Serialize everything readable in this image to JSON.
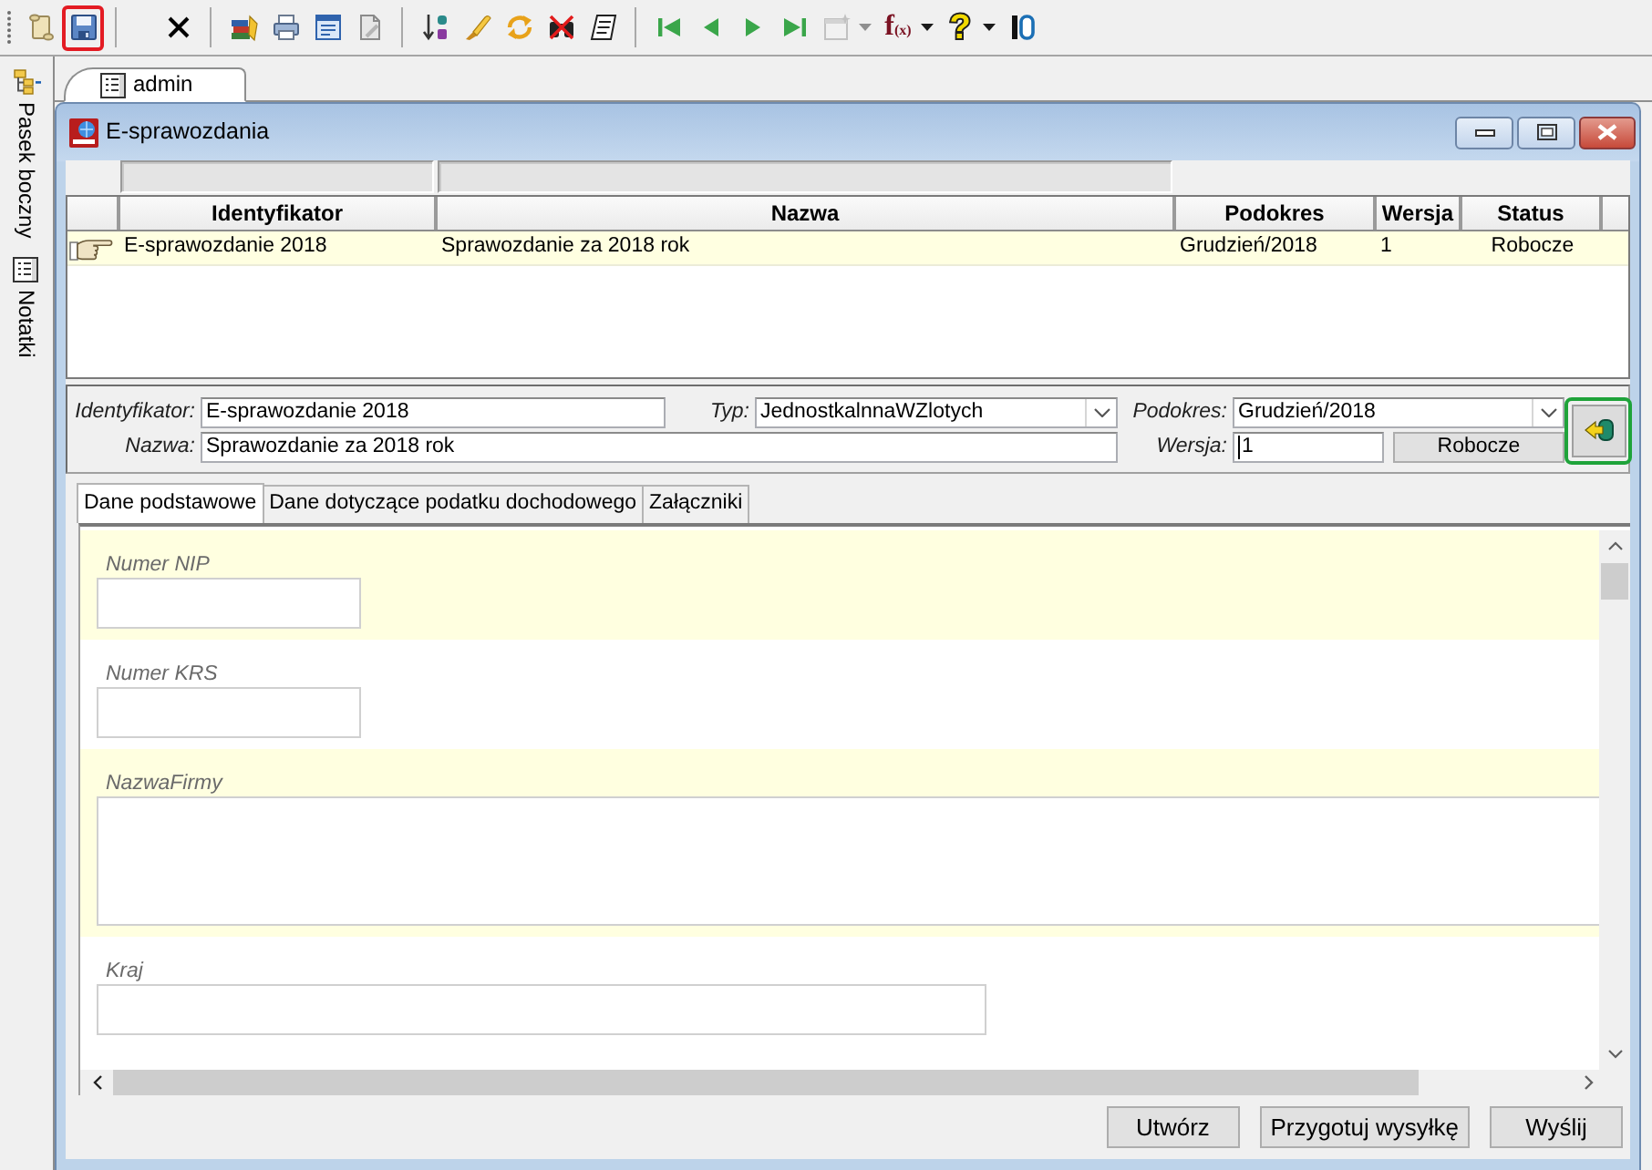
{
  "toolbar": [
    [
      {
        "kind": "button",
        "disabled": false,
        "highlighted": false
      },
      {
        "kind": "button",
        "disabled": false,
        "highlighted": true
      }
    ],
    [
      {
        "kind": "button",
        "disabled": false,
        "highlighted": false
      }
    ],
    [
      {
        "kind": "button",
        "disabled": false,
        "highlighted": false
      },
      {
        "kind": "button",
        "disabled": false,
        "highlighted": false
      },
      {
        "kind": "button",
        "disabled": false,
        "highlighted": false
      },
      {
        "kind": "button",
        "disabled": false,
        "highlighted": false
      }
    ],
    [
      {
        "kind": "button",
        "disabled": false,
        "highlighted": false
      },
      {
        "kind": "button",
        "disabled": false,
        "highlighted": false
      },
      {
        "kind": "button",
        "disabled": false,
        "highlighted": false
      },
      {
        "kind": "button",
        "disabled": false,
        "highlighted": false
      },
      {
        "kind": "button",
        "disabled": false,
        "highlighted": false
      }
    ],
    [
      {
        "kind": "button",
        "disabled": false,
        "highlighted": false
      },
      {
        "kind": "button",
        "disabled": false,
        "highlighted": false
      },
      {
        "kind": "button",
        "disabled": false,
        "highlighted": false
      },
      {
        "kind": "button",
        "disabled": false,
        "highlighted": false
      },
      {
        "kind": "dropdown",
        "disabled": true,
        "highlighted": false
      },
      {
        "kind": "dropdown",
        "disabled": false,
        "highlighted": false,
        "label": "f$_{(x)}$"
      },
      {
        "kind": "dropdown",
        "disabled": false,
        "highlighted": false,
        "label": "?"
      },
      {
        "kind": "button",
        "disabled": false,
        "highlighted": false
      }
    ]
  ],
  "sidebar": {
    "items": [
      {
        "label": "Pasek boczny"
      },
      {
        "label": "Notatki"
      }
    ]
  },
  "document_tabs": [
    {
      "label": "admin",
      "selected": true
    }
  ],
  "window": {
    "title": "E-sprawozdania"
  },
  "table": {
    "columns": [
      {
        "label": "Identyfikator",
        "has_filter": true
      },
      {
        "label": "Nazwa",
        "has_filter": true
      },
      {
        "label": "Podokres",
        "has_filter": false
      },
      {
        "label": "Wersja",
        "has_filter": false
      },
      {
        "label": "Status",
        "has_filter": false
      }
    ],
    "rows": [
      {
        "selected": true,
        "cells": [
          "E-sprawozdanie 2018",
          "Sprawozdanie za 2018 rok",
          "Grudzień/2018",
          "1",
          "Robocze"
        ]
      }
    ]
  },
  "record_form": {
    "identifier": {
      "label": "Identyfikator:",
      "value": "E-sprawozdanie 2018"
    },
    "type": {
      "label": "Typ:",
      "value": "JednostkalnnaWZlotych"
    },
    "period": {
      "label": "Podokres:",
      "value": "Grudzień/2018"
    },
    "name": {
      "label": "Nazwa:",
      "value": "Sprawozdanie za 2018 rok"
    },
    "version": {
      "label": "Wersja:",
      "value": "1",
      "focused": true
    },
    "status_button": {
      "label": "Robocze"
    },
    "action_button": {
      "highlighted": true
    }
  },
  "content_tabs": [
    {
      "label": "Dane podstawowe",
      "selected": true
    },
    {
      "label": "Dane dotyczące podatku dochodowego",
      "selected": false
    },
    {
      "label": "Załączniki",
      "selected": false
    }
  ],
  "fields": [
    {
      "label": "Numer NIP",
      "kind": "short"
    },
    {
      "label": "Numer KRS",
      "kind": "short"
    },
    {
      "label": "NazwaFirmy",
      "kind": "memo"
    },
    {
      "label": "Kraj",
      "kind": "medium"
    }
  ],
  "buttons": [
    {
      "label": "Utwórz"
    },
    {
      "label": "Przygotuj wysyłkę"
    },
    {
      "label": "Wyślij"
    }
  ]
}
